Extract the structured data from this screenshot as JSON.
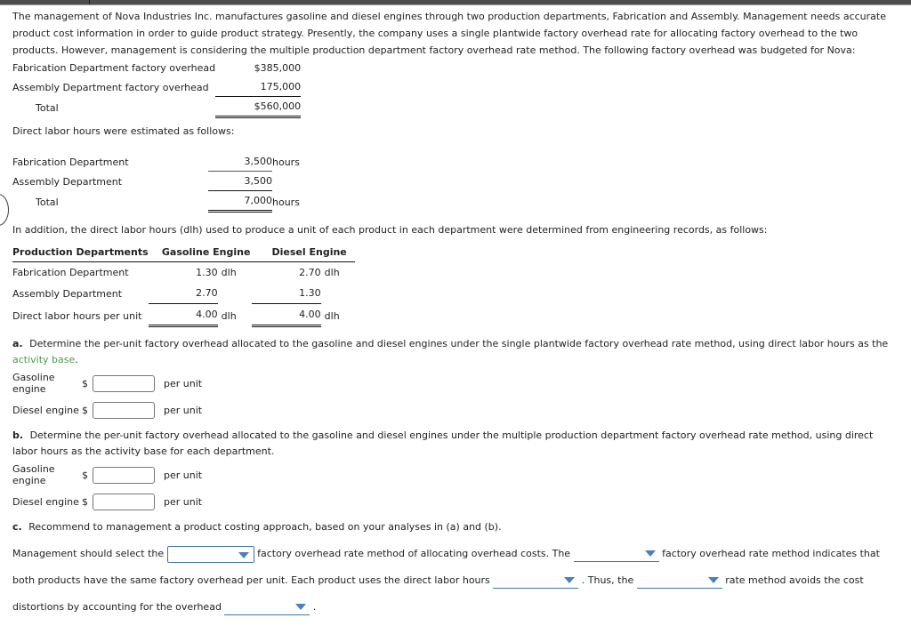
{
  "intro": {
    "paragraph": "The management of Nova Industries Inc. manufactures gasoline and diesel engines through two production departments, Fabrication and Assembly. Management needs accurate product cost information in order to guide product strategy. Presently, the company uses a single plantwide factory overhead rate for allocating factory overhead to the two products. However, management is considering the multiple production department factory overhead rate method. The following factory overhead was budgeted for Nova:"
  },
  "overhead_table": {
    "rows": [
      {
        "label": "Fabrication Department factory overhead",
        "value": "$385,000",
        "unit": ""
      },
      {
        "label": "Assembly Department factory overhead",
        "value": "175,000",
        "unit": ""
      },
      {
        "label": "Total",
        "value": "$560,000",
        "unit": ""
      }
    ]
  },
  "labor_lead": "Direct labor hours were estimated as follows:",
  "labor_table": {
    "rows": [
      {
        "label": "Fabrication Department",
        "value": "3,500",
        "unit": "hours"
      },
      {
        "label": "Assembly Department",
        "value": "3,500",
        "unit": ""
      },
      {
        "label": "Total",
        "value": "7,000",
        "unit": "hours"
      }
    ]
  },
  "dlh_lead": "In addition, the direct labor hours (dlh) used to produce a unit of each product in each department were determined from engineering records, as follows:",
  "dept_table": {
    "headers": [
      "Production Departments",
      "Gasoline Engine",
      "Diesel Engine"
    ],
    "rows": [
      {
        "label": "Fabrication Department",
        "gasoline": "1.30",
        "gasoline_unit": "dlh",
        "diesel": "2.70",
        "diesel_unit": "dlh"
      },
      {
        "label": "Assembly Department",
        "gasoline": "2.70",
        "gasoline_unit": "",
        "diesel": "1.30",
        "diesel_unit": ""
      },
      {
        "label": "Direct labor hours per unit",
        "gasoline": "4.00",
        "gasoline_unit": "dlh",
        "diesel": "4.00",
        "diesel_unit": "dlh"
      }
    ]
  },
  "question_a": {
    "mark": "a.",
    "text_before": "Determine the per-unit factory overhead allocated to the gasoline and diesel engines under the single plantwide factory overhead rate method, using direct labor hours as the",
    "glossary_term": "activity base",
    "text_after": ".",
    "answers": [
      {
        "name": "Gasoline engine",
        "dollar": "$",
        "value": "",
        "suffix": "per unit"
      },
      {
        "name": "Diesel engine",
        "dollar": "$",
        "value": "",
        "suffix": "per unit"
      }
    ]
  },
  "question_b": {
    "mark": "b.",
    "text": "Determine the per-unit factory overhead allocated to the gasoline and diesel engines under the multiple production department factory overhead rate method, using direct labor hours as the activity base for each department.",
    "answers": [
      {
        "name": "Gasoline engine",
        "dollar": "$",
        "value": "",
        "suffix": "per unit"
      },
      {
        "name": "Diesel engine",
        "dollar": "$",
        "value": "",
        "suffix": "per unit"
      }
    ]
  },
  "question_c": {
    "mark": "c.",
    "text": "Recommend to management a product costing approach, based on your analyses in (a) and (b).",
    "sentence": {
      "s1": "Management should select the",
      "s2": "factory overhead rate method of allocating overhead costs. The",
      "s3": "factory overhead rate method indicates that both products have the same factory overhead per unit. Each product uses the direct labor hours",
      "s4": ". Thus, the",
      "s5": "rate method avoids the cost distortions by accounting for the overhead",
      "s6": "."
    },
    "dropdowns": [
      {
        "name": "method-select-1",
        "value": "",
        "style": "boxed"
      },
      {
        "name": "method-select-2",
        "value": "",
        "style": "line"
      },
      {
        "name": "usage-select-3",
        "value": "",
        "style": "line"
      },
      {
        "name": "method-select-4",
        "value": "",
        "style": "line"
      },
      {
        "name": "overhead-select-5",
        "value": "",
        "style": "line"
      }
    ]
  },
  "colors": {
    "glossary_green": "#4f9a4f",
    "dropdown_blue": "#3f72b5",
    "chevron_blue": "#4a7fc1",
    "topbar_gray": "#4e4e4e"
  }
}
